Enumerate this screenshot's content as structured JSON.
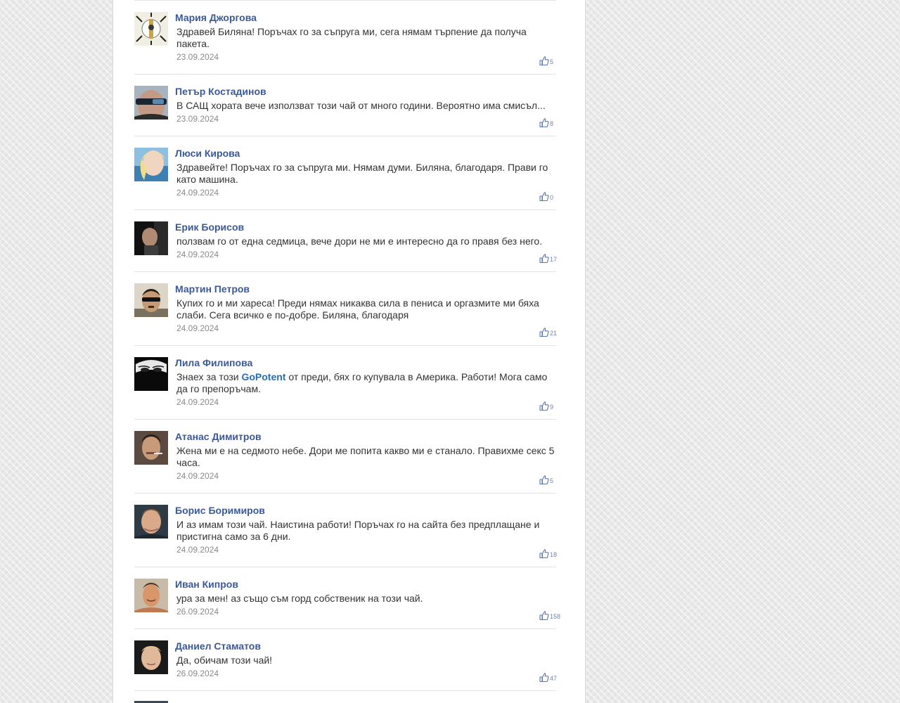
{
  "link_color": "#2b6cb0",
  "name_color": "#3b5998",
  "comments": [
    {
      "name": "Мария Джоргова",
      "text": "Здравей Биляна! Поръчах го за съпруга ми, сега нямам търпение да получа пакета.",
      "date": "23.09.2024",
      "likes": "5"
    },
    {
      "name": "Петър Костадинов",
      "text": "В САЩ хората вече използват този чай от много години. Вероятно има смисъл...",
      "date": "23.09.2024",
      "likes": "8"
    },
    {
      "name": "Люси Кирова",
      "text": "Здравейте! Поръчах го за съпруга ми. Нямам думи. Биляна, благодаря. Прави го като машина.",
      "date": "24.09.2024",
      "likes": "0"
    },
    {
      "name": "Ерик Борисов",
      "text": "ползвам го от една седмица, вече дори не ми е интересно да го правя без него.",
      "date": "24.09.2024",
      "likes": "17"
    },
    {
      "name": "Мартин Петров",
      "text": "Купих го и ми хареса! Преди нямах никаква сила в пениса и оргазмите ми бяха слаби. Сега всичко е по-добре. Биляна, благодаря",
      "date": "24.09.2024",
      "likes": "21"
    },
    {
      "name": "Лила Филипова",
      "text_before": "Знаех за този ",
      "link": "GoPotent",
      "text_after": " от преди, бях го купувала в Америка. Работи! Мога само да го препоръчам.",
      "date": "24.09.2024",
      "likes": "9"
    },
    {
      "name": "Атанас Димитров",
      "text": "Жена ми е на седмото небе. Дори ме попита какво ми е станало. Правихме секс 5 часа.",
      "date": "24.09.2024",
      "likes": "5"
    },
    {
      "name": "Борис Боримиров",
      "text": "И аз имам този чай. Наистина работи! Поръчах го на сайта без предплащане и пристигна само за 6 дни.",
      "date": "24.09.2024",
      "likes": "18"
    },
    {
      "name": "Иван Кипров",
      "text": "ура за мен! аз също съм горд собственик на този чай.",
      "date": "26.09.2024",
      "likes": "158"
    },
    {
      "name": "Даниел Стаматов",
      "text": "Да, обичам този чай!",
      "date": "26.09.2024",
      "likes": "47"
    }
  ]
}
